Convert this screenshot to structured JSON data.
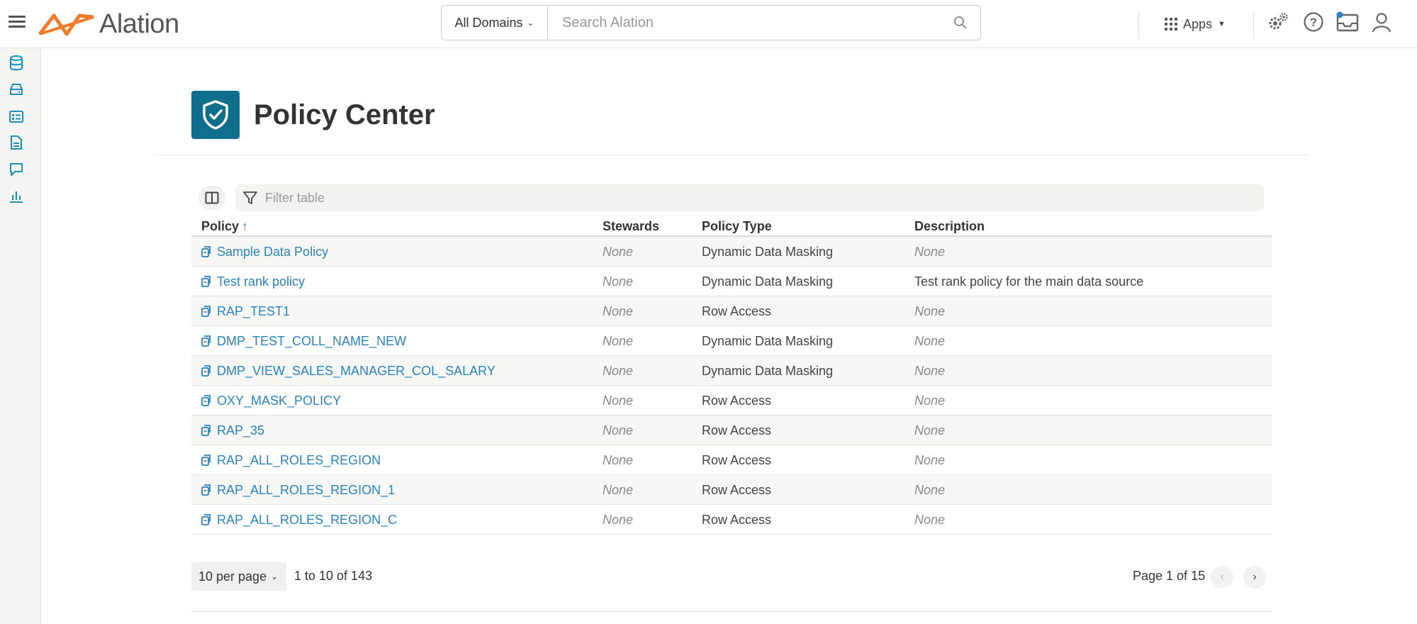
{
  "app": {
    "logo_text": "Alation",
    "colors": {
      "accent": "#0e6e8c",
      "link": "#2a82be",
      "logo_orange": "#f27b28"
    }
  },
  "search": {
    "domain_label": "All Domains",
    "placeholder": "Search Alation"
  },
  "topnav": {
    "apps_label": "Apps",
    "icons": [
      "settings-icon",
      "help-icon",
      "inbox-icon",
      "user-icon"
    ]
  },
  "leftrail": {
    "icons": [
      "database-icon",
      "storage-icon",
      "catalog-icon",
      "document-icon",
      "conversation-icon",
      "analytics-icon"
    ]
  },
  "page": {
    "title": "Policy Center",
    "filter_placeholder": "Filter table"
  },
  "table": {
    "columns": {
      "policy": "Policy",
      "stewards": "Stewards",
      "policy_type": "Policy Type",
      "description": "Description"
    },
    "rows": [
      {
        "policy": "Sample Data Policy",
        "stewards": "None",
        "policy_type": "Dynamic Data Masking",
        "description": "None"
      },
      {
        "policy": "Test rank policy",
        "stewards": "None",
        "policy_type": "Dynamic Data Masking",
        "description": "Test rank policy for the main data source"
      },
      {
        "policy": "RAP_TEST1",
        "stewards": "None",
        "policy_type": "Row Access",
        "description": "None"
      },
      {
        "policy": "DMP_TEST_COLL_NAME_NEW",
        "stewards": "None",
        "policy_type": "Dynamic Data Masking",
        "description": "None"
      },
      {
        "policy": "DMP_VIEW_SALES_MANAGER_COL_SALARY",
        "stewards": "None",
        "policy_type": "Dynamic Data Masking",
        "description": "None"
      },
      {
        "policy": "OXY_MASK_POLICY",
        "stewards": "None",
        "policy_type": "Row Access",
        "description": "None"
      },
      {
        "policy": "RAP_35",
        "stewards": "None",
        "policy_type": "Row Access",
        "description": "None"
      },
      {
        "policy": "RAP_ALL_ROLES_REGION",
        "stewards": "None",
        "policy_type": "Row Access",
        "description": "None"
      },
      {
        "policy": "RAP_ALL_ROLES_REGION_1",
        "stewards": "None",
        "policy_type": "Row Access",
        "description": "None"
      },
      {
        "policy": "RAP_ALL_ROLES_REGION_C",
        "stewards": "None",
        "policy_type": "Row Access",
        "description": "None"
      }
    ]
  },
  "pagination": {
    "per_page_label": "10 per page",
    "range_label": "1 to 10 of 143",
    "page_label": "Page 1 of 15"
  }
}
